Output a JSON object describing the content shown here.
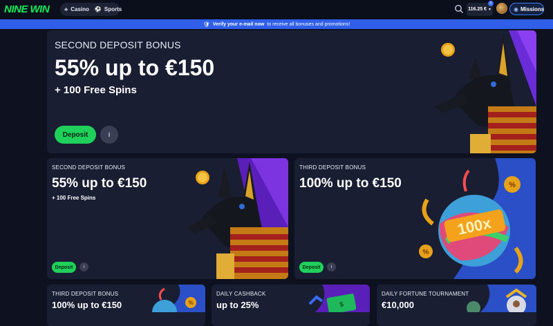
{
  "header": {
    "logo": "NINE WIN",
    "nav": [
      {
        "label": "Casino",
        "icon": "casino-icon"
      },
      {
        "label": "Sports",
        "icon": "sports-icon"
      }
    ],
    "balance": "116.25 €",
    "balance_badge": "0",
    "missions_label": "Missions"
  },
  "verify_banner": {
    "strong": "Verify your e-mail now",
    "rest": "to receive all bonuses and promotions!"
  },
  "colors": {
    "brand_green": "#1fd15b",
    "banner_blue": "#2f5fe8",
    "card_bg": "#1a1e33",
    "page_bg": "#0e1120"
  },
  "hero": {
    "label": "SECOND DEPOSIT BONUS",
    "headline": "55% up to €150",
    "sub": "+ 100 Free Spins",
    "deposit_label": "Deposit",
    "info_label": "i"
  },
  "cards": [
    {
      "label": "SECOND DEPOSIT BONUS",
      "headline": "55% up to €150",
      "sub": "+ 100 Free Spins",
      "deposit_label": "Deposit",
      "info_label": "i"
    },
    {
      "label": "THIRD DEPOSIT BONUS",
      "headline": "100% up to €150",
      "deposit_label": "Deposit",
      "info_label": "i"
    }
  ],
  "bottom_cards": [
    {
      "label": "THIRD DEPOSIT BONUS",
      "headline": "100% up to €150"
    },
    {
      "label": "DAILY CASHBACK",
      "headline": "up to 25%"
    },
    {
      "label": "DAILY FORTUNE TOURNAMENT",
      "headline": "€10,000"
    }
  ]
}
